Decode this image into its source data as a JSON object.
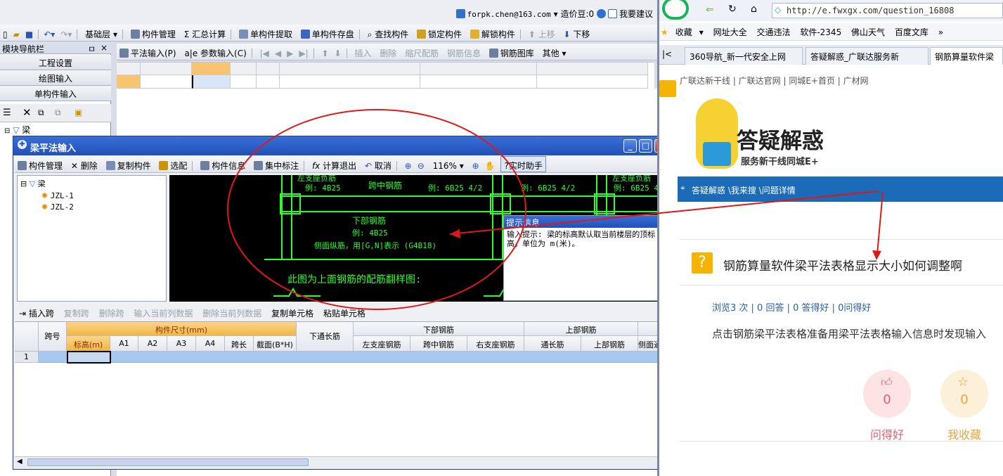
{
  "app": {
    "account_email": "forpk.chen@163.com",
    "price_beans": "造价豆:0",
    "suggest": "我要建议",
    "floor": "基础层",
    "toolbar1": [
      "构件管理",
      "汇总计算",
      "单构件提取",
      "单构件存盘",
      "查找构件",
      "锁定构件",
      "解锁构件",
      "上移",
      "下移"
    ],
    "toolbar2": [
      "平法输入(P)",
      "参数输入(C)",
      "插入",
      "删除",
      "缩尺配筋",
      "钢筋信息",
      "钢筋图库",
      "其他"
    ],
    "nav": {
      "title": "模块导航栏",
      "pin": "ㅁ",
      "close": "×",
      "buttons": [
        "工程设置",
        "绘图输入",
        "单构件输入"
      ],
      "tree_root": "梁"
    }
  },
  "dialog": {
    "title": "梁平法输入",
    "toolbar": [
      "构件管理",
      "删除",
      "复制构件",
      "选配",
      "构件信息",
      "集中标注",
      "计算退出",
      "取消"
    ],
    "zoom": "116%",
    "helper": "实时助手",
    "tree": {
      "root": "梁",
      "items": [
        "JZL-1",
        "JZL-2"
      ]
    },
    "canvas_text": {
      "t1": "左支座负筋",
      "t2": "例: 4B25",
      "t3": "跨中钢筋",
      "t4": "例: 6B25 4/2",
      "t5": "例: 6B25 4/2",
      "t6": "左支座负筋",
      "t7": "例: 6B25 4/",
      "t8": "下部钢筋",
      "t9": "例: 4B25",
      "t10": "侧面纵筋，用[G,N]表示 (G4B18)",
      "t11": "此图为上面钢筋的配筋翻样图:"
    },
    "hint": {
      "title": "提示信息",
      "body": "输入提示: 梁的标高默认取当前楼层的顶标高，单位为 m(米)。"
    },
    "bar2": [
      "插入跨",
      "复制跨",
      "删除跨",
      "输入当前列数据",
      "删除当前列数据",
      "复制单元格",
      "粘贴单元格"
    ],
    "table": {
      "span": "跨号",
      "size_group": "构件尺寸(mm)",
      "size_cols": [
        "标高(m)",
        "A1",
        "A2",
        "A3",
        "A4",
        "跨长",
        "截面(B*H)"
      ],
      "through": "下通长筋",
      "bottom_group": "下部钢筋",
      "bottom_cols": [
        "左支座钢筋",
        "跨中钢筋",
        "右支座钢筋"
      ],
      "top_group": "上部钢筋",
      "top_cols": [
        "通长筋",
        "上部钢筋"
      ],
      "side": "侧面通",
      "row1": "1"
    }
  },
  "browser": {
    "url": "http://e.fwxgx.com/question_16808",
    "bookmarks": [
      "收藏",
      "网址大全",
      "交通违法",
      "软件-2345",
      "佛山天气",
      "百度文库"
    ],
    "tabs": [
      "360导航_新一代安全上网",
      "答疑解惑_广联达服务新",
      "钢筋算量软件梁"
    ],
    "site_links": "广联达新干线  |  广联达官网  |  同城E+首页  |  广材网",
    "logo_main": "答疑解惑",
    "logo_sub": "服务新干线同城E+",
    "breadcrumb": "答疑解惑 \\我来搜 \\问题详情",
    "question_title": "钢筋算量软件梁平法表格显示大小如何调整啊",
    "stats": "浏览3 次 | 0 回答 | 0 答得好 | 0问得好",
    "description": "点击钢筋梁平法表格准备用梁平法表格输入信息时发现输入",
    "like_count": "0",
    "like_label": "问得好",
    "fav_count": "0",
    "fav_label": "我收藏"
  }
}
